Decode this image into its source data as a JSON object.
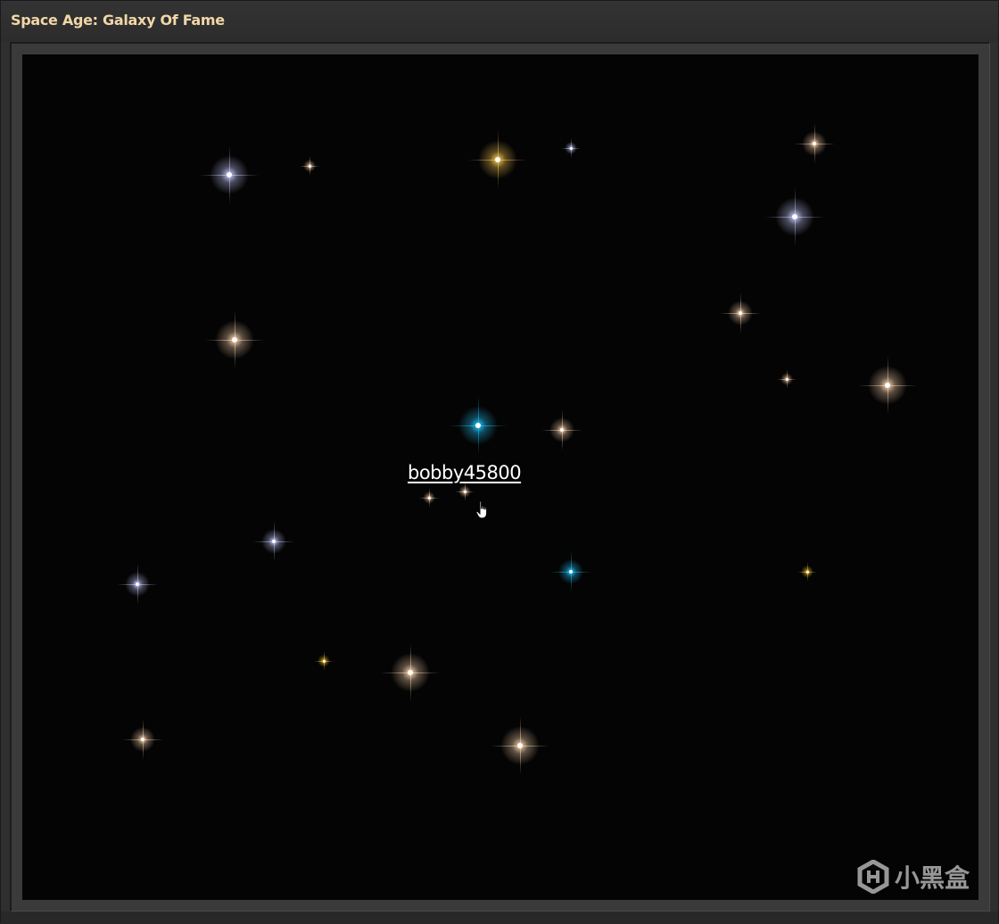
{
  "window": {
    "title": "Space Age: Galaxy Of Fame"
  },
  "galaxy": {
    "selected_player": "bobby45800",
    "stars": [
      {
        "color": "#c8ccff",
        "size": "large"
      },
      {
        "color": "#ffd6b0",
        "size": "small"
      },
      {
        "color": "#ffcc55",
        "size": "large"
      },
      {
        "color": "#c8ccff",
        "size": "small"
      },
      {
        "color": "#ffd6b0",
        "size": "medium"
      },
      {
        "color": "#c8ccff",
        "size": "large"
      },
      {
        "color": "#ffd6b0",
        "size": "large"
      },
      {
        "color": "#ffd6b0",
        "size": "medium"
      },
      {
        "color": "#ffd6b0",
        "size": "small"
      },
      {
        "color": "#ffd6b0",
        "size": "large"
      },
      {
        "color": "#22c8ff",
        "size": "large"
      },
      {
        "color": "#ffd6b0",
        "size": "medium"
      },
      {
        "color": "#ffd6b0",
        "size": "small"
      },
      {
        "color": "#ffd6b0",
        "size": "small"
      },
      {
        "color": "#c8ccff",
        "size": "medium"
      },
      {
        "color": "#22c8ff",
        "size": "medium"
      },
      {
        "color": "#ffcc33",
        "size": "small"
      },
      {
        "color": "#c8ccff",
        "size": "medium"
      },
      {
        "color": "#ffcc33",
        "size": "small"
      },
      {
        "color": "#ffd6b0",
        "size": "large"
      },
      {
        "color": "#ffd6b0",
        "size": "medium"
      },
      {
        "color": "#ffd6b0",
        "size": "large"
      }
    ]
  },
  "watermark": {
    "text": "小黑盒",
    "icon": "heybox-logo-icon"
  }
}
